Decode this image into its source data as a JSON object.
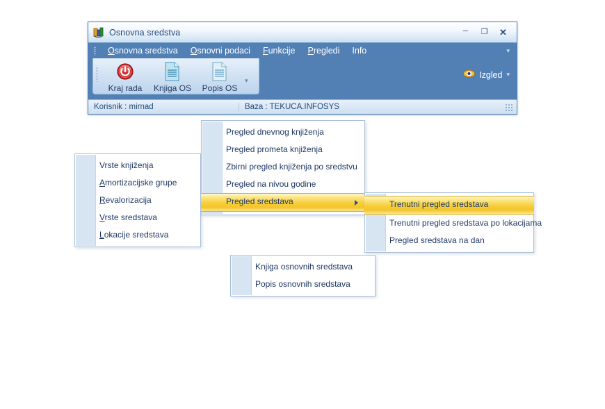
{
  "window": {
    "title": "Osnovna sredstva",
    "icon": "app-icon",
    "buttons": {
      "minimize": "–",
      "maximize": "❐",
      "close": "✕"
    },
    "menubar": {
      "items": [
        {
          "label": "Osnovna sredstva",
          "accel": "O"
        },
        {
          "label": "Osnovni podaci",
          "accel": "O"
        },
        {
          "label": "Funkcije",
          "accel": "F"
        },
        {
          "label": "Pregledi",
          "accel": "P"
        },
        {
          "label": "Info",
          "accel": ""
        }
      ],
      "overflow_caret": "▾"
    },
    "ribbon": {
      "buttons": [
        {
          "label": "Kraj rada",
          "icon": "power-icon"
        },
        {
          "label": "Knjiga OS",
          "icon": "document-icon"
        },
        {
          "label": "Popis OS",
          "icon": "document-icon"
        }
      ],
      "expand_caret": "▾",
      "view": {
        "label": "Izgled",
        "icon": "eye-icon",
        "caret": "▾"
      }
    },
    "statusbar": {
      "user": "Korisnik : mirnad",
      "database": "Baza : TEKUCA.INFOSYS"
    }
  },
  "menus": {
    "osnovni_podaci": {
      "name": "Osnovni podaci",
      "items": [
        {
          "label": "Vrste knjiženja",
          "accel": "",
          "selected": false,
          "submenu": false
        },
        {
          "label": "Amortizacijske grupe",
          "accel": "A",
          "selected": false,
          "submenu": false
        },
        {
          "label": "Revalorizacija",
          "accel": "R",
          "selected": false,
          "submenu": false
        },
        {
          "label": "Vrste sredstava",
          "accel": "V",
          "selected": false,
          "submenu": false
        },
        {
          "label": "Lokacije sredstava",
          "accel": "L",
          "selected": false,
          "submenu": false
        }
      ]
    },
    "pregledi": {
      "name": "Pregledi",
      "items": [
        {
          "label": "Pregled dnevnog knjiženja",
          "accel": "",
          "selected": false,
          "submenu": false
        },
        {
          "label": "Pregled prometa knjiženja",
          "accel": "",
          "selected": false,
          "submenu": false
        },
        {
          "label": "Zbirni pregled knjiženja po sredstvu",
          "accel": "",
          "selected": false,
          "submenu": false
        },
        {
          "label": "Pregled na nivou godine",
          "accel": "",
          "selected": false,
          "submenu": false
        },
        {
          "label": "Pregled sredstava",
          "accel": "",
          "selected": true,
          "submenu": true
        }
      ]
    },
    "pregled_sredstava": {
      "name": "Pregled sredstava",
      "items": [
        {
          "label": "Trenutni pregled sredstava",
          "accel": "",
          "selected": true,
          "submenu": false
        },
        {
          "label": "Trenutni pregled sredstava po lokacijama",
          "accel": "",
          "selected": false,
          "submenu": false
        },
        {
          "label": "Pregled sredstava na dan",
          "accel": "",
          "selected": false,
          "submenu": false
        }
      ]
    },
    "funkcije": {
      "name": "Funkcije",
      "items": [
        {
          "label": "Knjiga osnovnih sredstava",
          "accel": "",
          "selected": false,
          "submenu": false
        },
        {
          "label": "Popis osnovnih sredstava",
          "accel": "",
          "selected": false,
          "submenu": false
        }
      ]
    }
  },
  "colors": {
    "ribbon_blue": "#5280b5",
    "menu_text": "#1f3864",
    "highlight_gold": "#f3c52a",
    "highlight_border": "#e0ab24",
    "gutter": "#d7e4f2",
    "power_red": "#cf2020",
    "doc_blue": "#a8d4e6"
  }
}
